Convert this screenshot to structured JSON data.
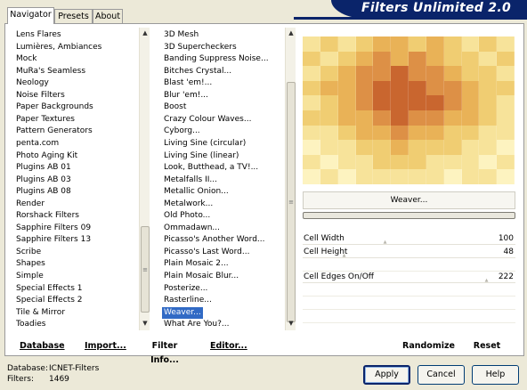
{
  "app": {
    "title": "Filters Unlimited 2.0"
  },
  "tabs": [
    {
      "label": "Navigator",
      "active": true
    },
    {
      "label": "Presets",
      "active": false
    },
    {
      "label": "About",
      "active": false
    }
  ],
  "categories": [
    "Lens Flares",
    "Lumières, Ambiances",
    "Mock",
    "MuRa's Seamless",
    "Neology",
    "Noise Filters",
    "Paper Backgrounds",
    "Paper Textures",
    "Pattern Generators",
    "penta.com",
    "Photo Aging Kit",
    "Plugins AB 01",
    "Plugins AB 03",
    "Plugins AB 08",
    "Render",
    "Rorshack Filters",
    "Sapphire Filters 09",
    "Sapphire Filters 13",
    "Scribe",
    "Shapes",
    "Simple",
    "Special Effects 1",
    "Special Effects 2",
    "Tile & Mirror",
    "Toadies"
  ],
  "filters": [
    "3D Mesh",
    "3D Supercheckers",
    "Banding Suppress Noise...",
    "Bitches Crystal...",
    "Blast 'em!...",
    "Blur 'em!...",
    "Boost",
    "Crazy Colour Waves...",
    "Cyborg...",
    "Living Sine (circular)",
    "Living Sine (linear)",
    "Look, Butthead, a TV!...",
    "Metalfalls II...",
    "Metallic Onion...",
    "Metalwork...",
    "Old Photo...",
    "Ommadawn...",
    "Picasso's Another Word...",
    "Picasso's Last Word...",
    "Plain Mosaic 2...",
    "Plain Mosaic Blur...",
    "Posterize...",
    "Rasterline...",
    "Weaver...",
    "What Are You?..."
  ],
  "selected_filter": "Weaver...",
  "filter_name_button": "Weaver...",
  "params": [
    {
      "label": "Cell Width",
      "value": "100"
    },
    {
      "label": "Cell Height",
      "value": "48"
    },
    {
      "label": "Cell Edges On/Off",
      "value": "222"
    }
  ],
  "toolbar": {
    "database": "Database",
    "import": "Import...",
    "filter_info": "Filter Info...",
    "editor": "Editor...",
    "randomize": "Randomize",
    "reset": "Reset"
  },
  "footer": {
    "database_label": "Database:",
    "database_value": "ICNET-Filters",
    "filters_label": "Filters:",
    "filters_value": "1469"
  },
  "buttons": {
    "apply": "Apply",
    "cancel": "Cancel",
    "help": "Help"
  },
  "colors": {
    "banner": "#0a246a",
    "selection": "#316ac5",
    "preview_palette": [
      "#fdf3c0",
      "#f7e39a",
      "#f0cd72",
      "#e9b257",
      "#dd9046",
      "#c9662f"
    ]
  }
}
